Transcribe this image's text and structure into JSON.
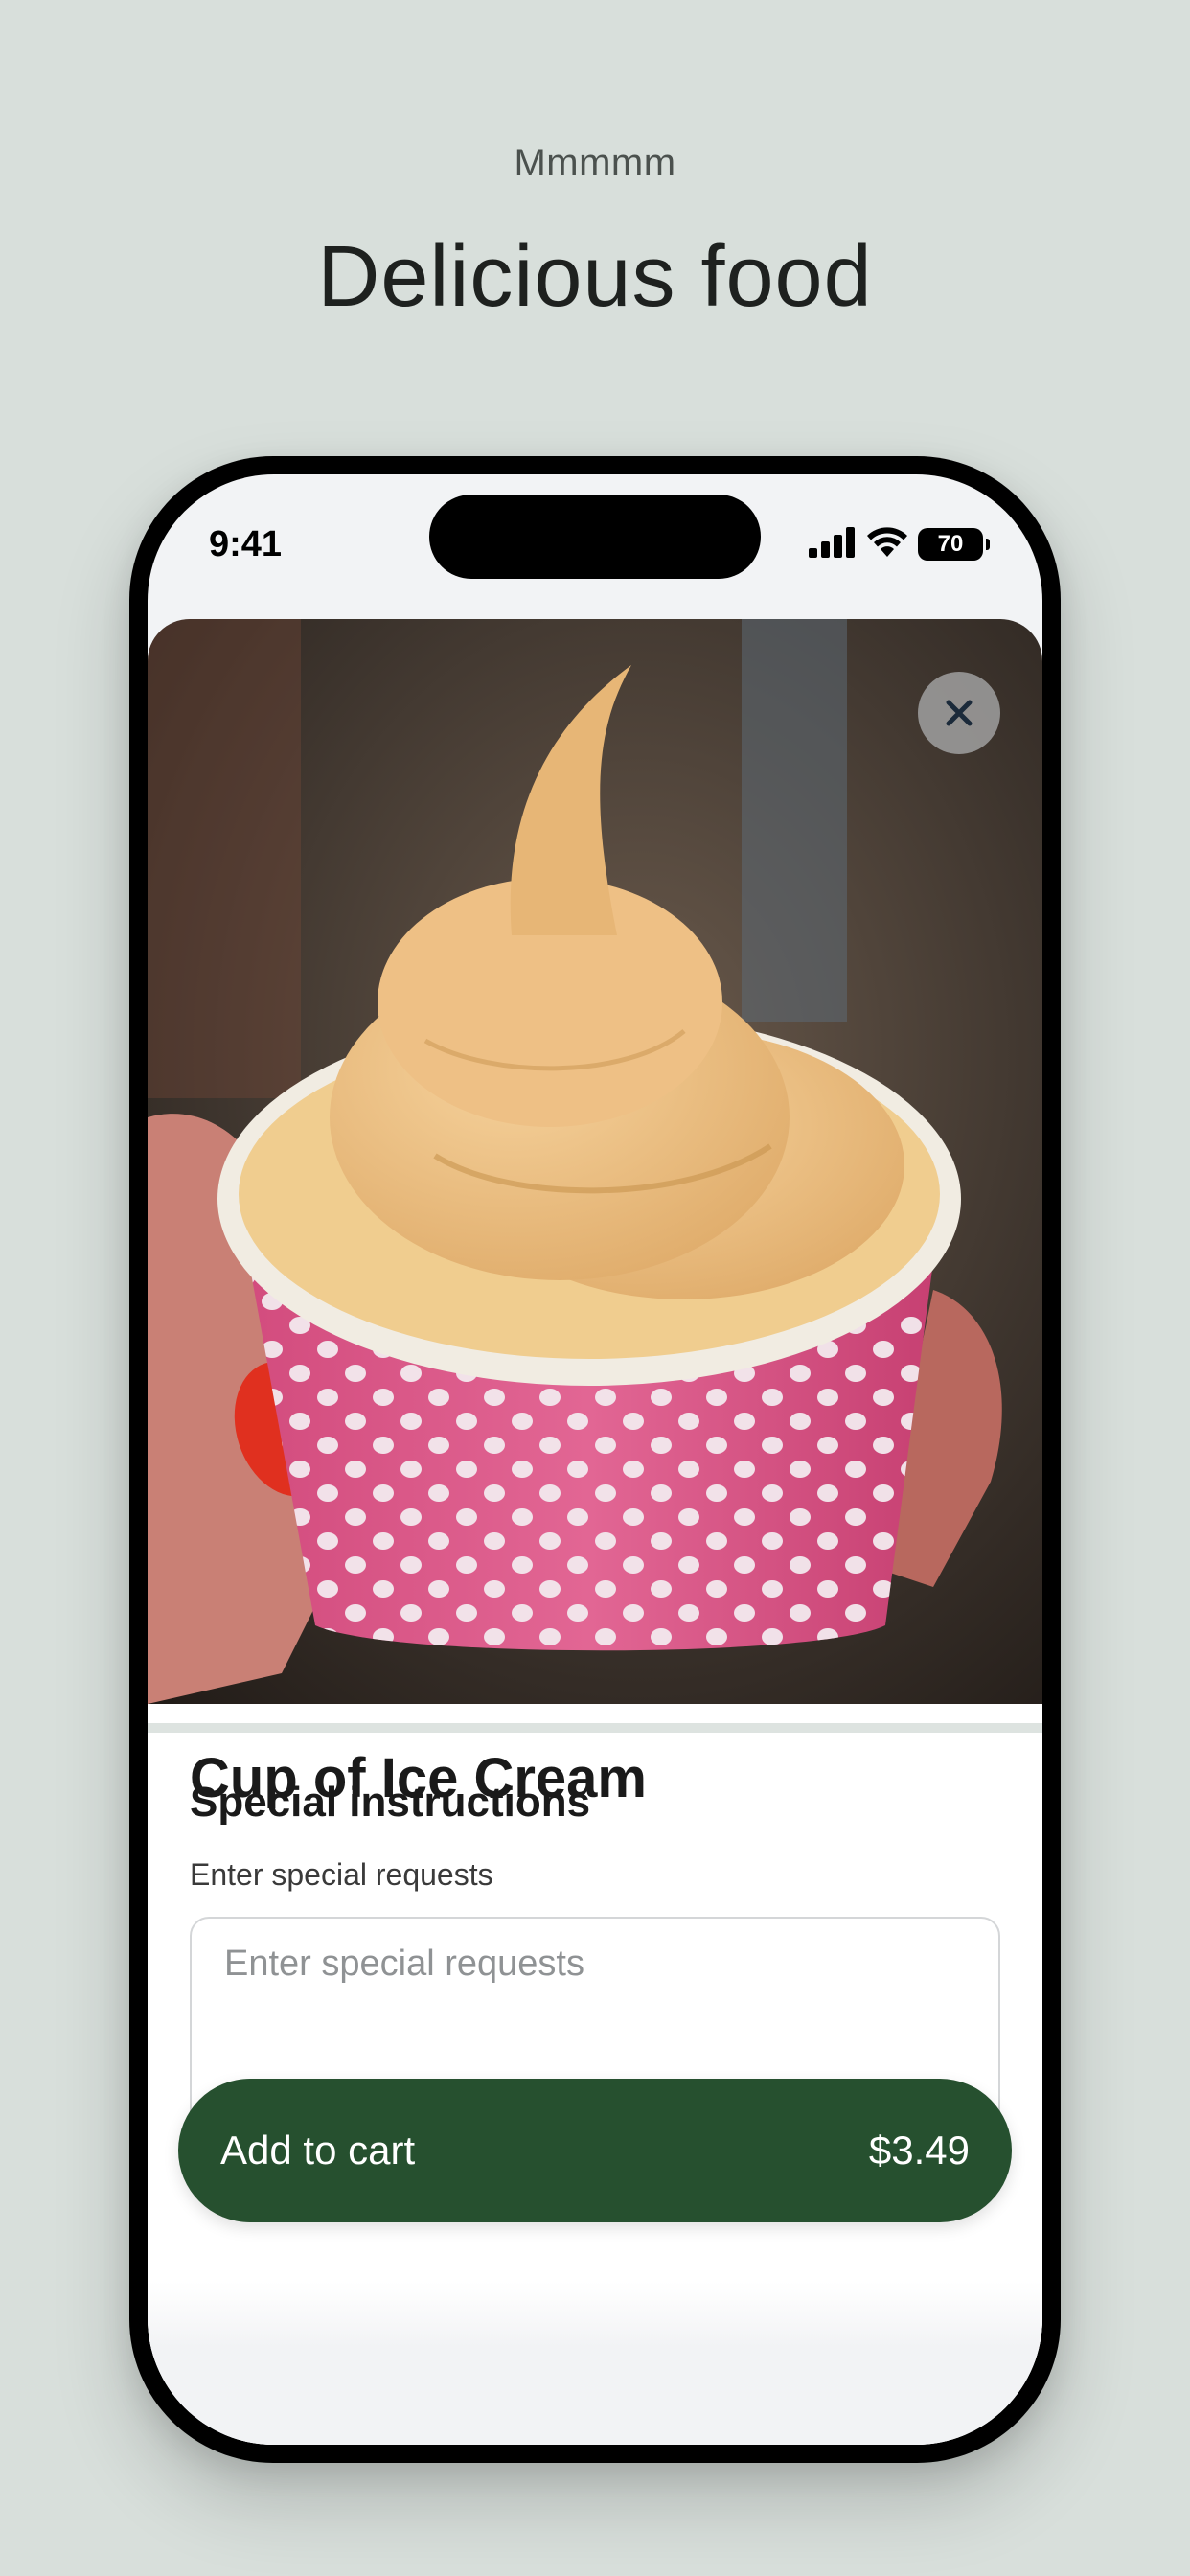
{
  "header": {
    "eyebrow": "Mmmmm",
    "headline": "Delicious food"
  },
  "status_bar": {
    "time": "9:41",
    "battery": "70",
    "icons": [
      "signal-icon",
      "wifi-icon",
      "battery-icon"
    ]
  },
  "item": {
    "title": "Cup of Ice Cream",
    "image_subject": "soft-serve ice cream in pink polka-dot paper cup"
  },
  "special_instructions": {
    "title": "Special instructions",
    "subtitle": "Enter special requests",
    "placeholder": "Enter special requests",
    "value": ""
  },
  "cart": {
    "label": "Add to cart",
    "price": "$3.49"
  },
  "colors": {
    "background": "#d8dfdb",
    "primary_button": "#26502f",
    "close_button": "#a0a0a0"
  }
}
